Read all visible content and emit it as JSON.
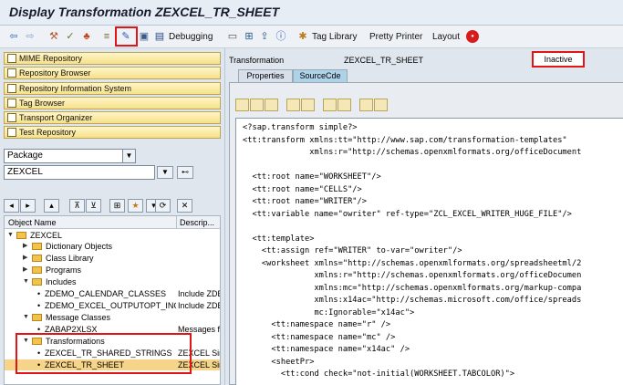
{
  "window": {
    "title": "Display Transformation ZEXCEL_TR_SHEET"
  },
  "toolbar": {
    "debugging_label": "Debugging",
    "tag_library_label": "Tag Library",
    "pretty_printer_label": "Pretty Printer",
    "layout_label": "Layout"
  },
  "nav": {
    "items": [
      "MIME Repository",
      "Repository Browser",
      "Repository Information System",
      "Tag Browser",
      "Transport Organizer",
      "Test Repository"
    ]
  },
  "object_selector": {
    "type": "Package",
    "name": "ZEXCEL"
  },
  "tree": {
    "columns": {
      "name": "Object Name",
      "description": "Descrip..."
    },
    "rows": [
      {
        "label": "ZEXCEL",
        "desc": ""
      },
      {
        "label": "Dictionary Objects",
        "desc": ""
      },
      {
        "label": "Class Library",
        "desc": ""
      },
      {
        "label": "Programs",
        "desc": ""
      },
      {
        "label": "Includes",
        "desc": ""
      },
      {
        "label": "ZDEMO_CALENDAR_CLASSES",
        "desc": "Include ZDE"
      },
      {
        "label": "ZDEMO_EXCEL_OUTPUTOPT_INCL",
        "desc": "Include ZDE"
      },
      {
        "label": "Message Classes",
        "desc": ""
      },
      {
        "label": "ZABAP2XLSX",
        "desc": "Messages fo"
      },
      {
        "label": "Transformations",
        "desc": ""
      },
      {
        "label": "ZEXCEL_TR_SHARED_STRINGS",
        "desc": "ZEXCEL Simp"
      },
      {
        "label": "ZEXCEL_TR_SHEET",
        "desc": "ZEXCEL Simp"
      }
    ]
  },
  "header": {
    "label": "Transformation",
    "name": "ZEXCEL_TR_SHEET",
    "status": "Inactive"
  },
  "tabs": [
    "Properties",
    "SourceCde"
  ],
  "source_lines": [
    "<?sap.transform simple?>",
    "<tt:transform xmlns:tt=\"http://www.sap.com/transformation-templates\"",
    "              xmlns:r=\"http://schemas.openxmlformats.org/officeDocument",
    "",
    "  <tt:root name=\"WORKSHEET\"/>",
    "  <tt:root name=\"CELLS\"/>",
    "  <tt:root name=\"WRITER\"/>",
    "  <tt:variable name=\"owriter\" ref-type=\"ZCL_EXCEL_WRITER_HUGE_FILE\"/>",
    "",
    "  <tt:template>",
    "    <tt:assign ref=\"WRITER\" to-var=\"owriter\"/>",
    "    <worksheet xmlns=\"http://schemas.openxmlformats.org/spreadsheetml/2",
    "               xmlns:r=\"http://schemas.openxmlformats.org/officeDocumen",
    "               xmlns:mc=\"http://schemas.openxmlformats.org/markup-compa",
    "               xmlns:x14ac=\"http://schemas.microsoft.com/office/spreads",
    "               mc:Ignorable=\"x14ac\">",
    "      <tt:namespace name=\"r\" />",
    "      <tt:namespace name=\"mc\" />",
    "      <tt:namespace name=\"x14ac\" />",
    "      <sheetPr>",
    "        <tt:cond check=\"not-initial(WORKSHEET.TABCOLOR)\">"
  ]
}
